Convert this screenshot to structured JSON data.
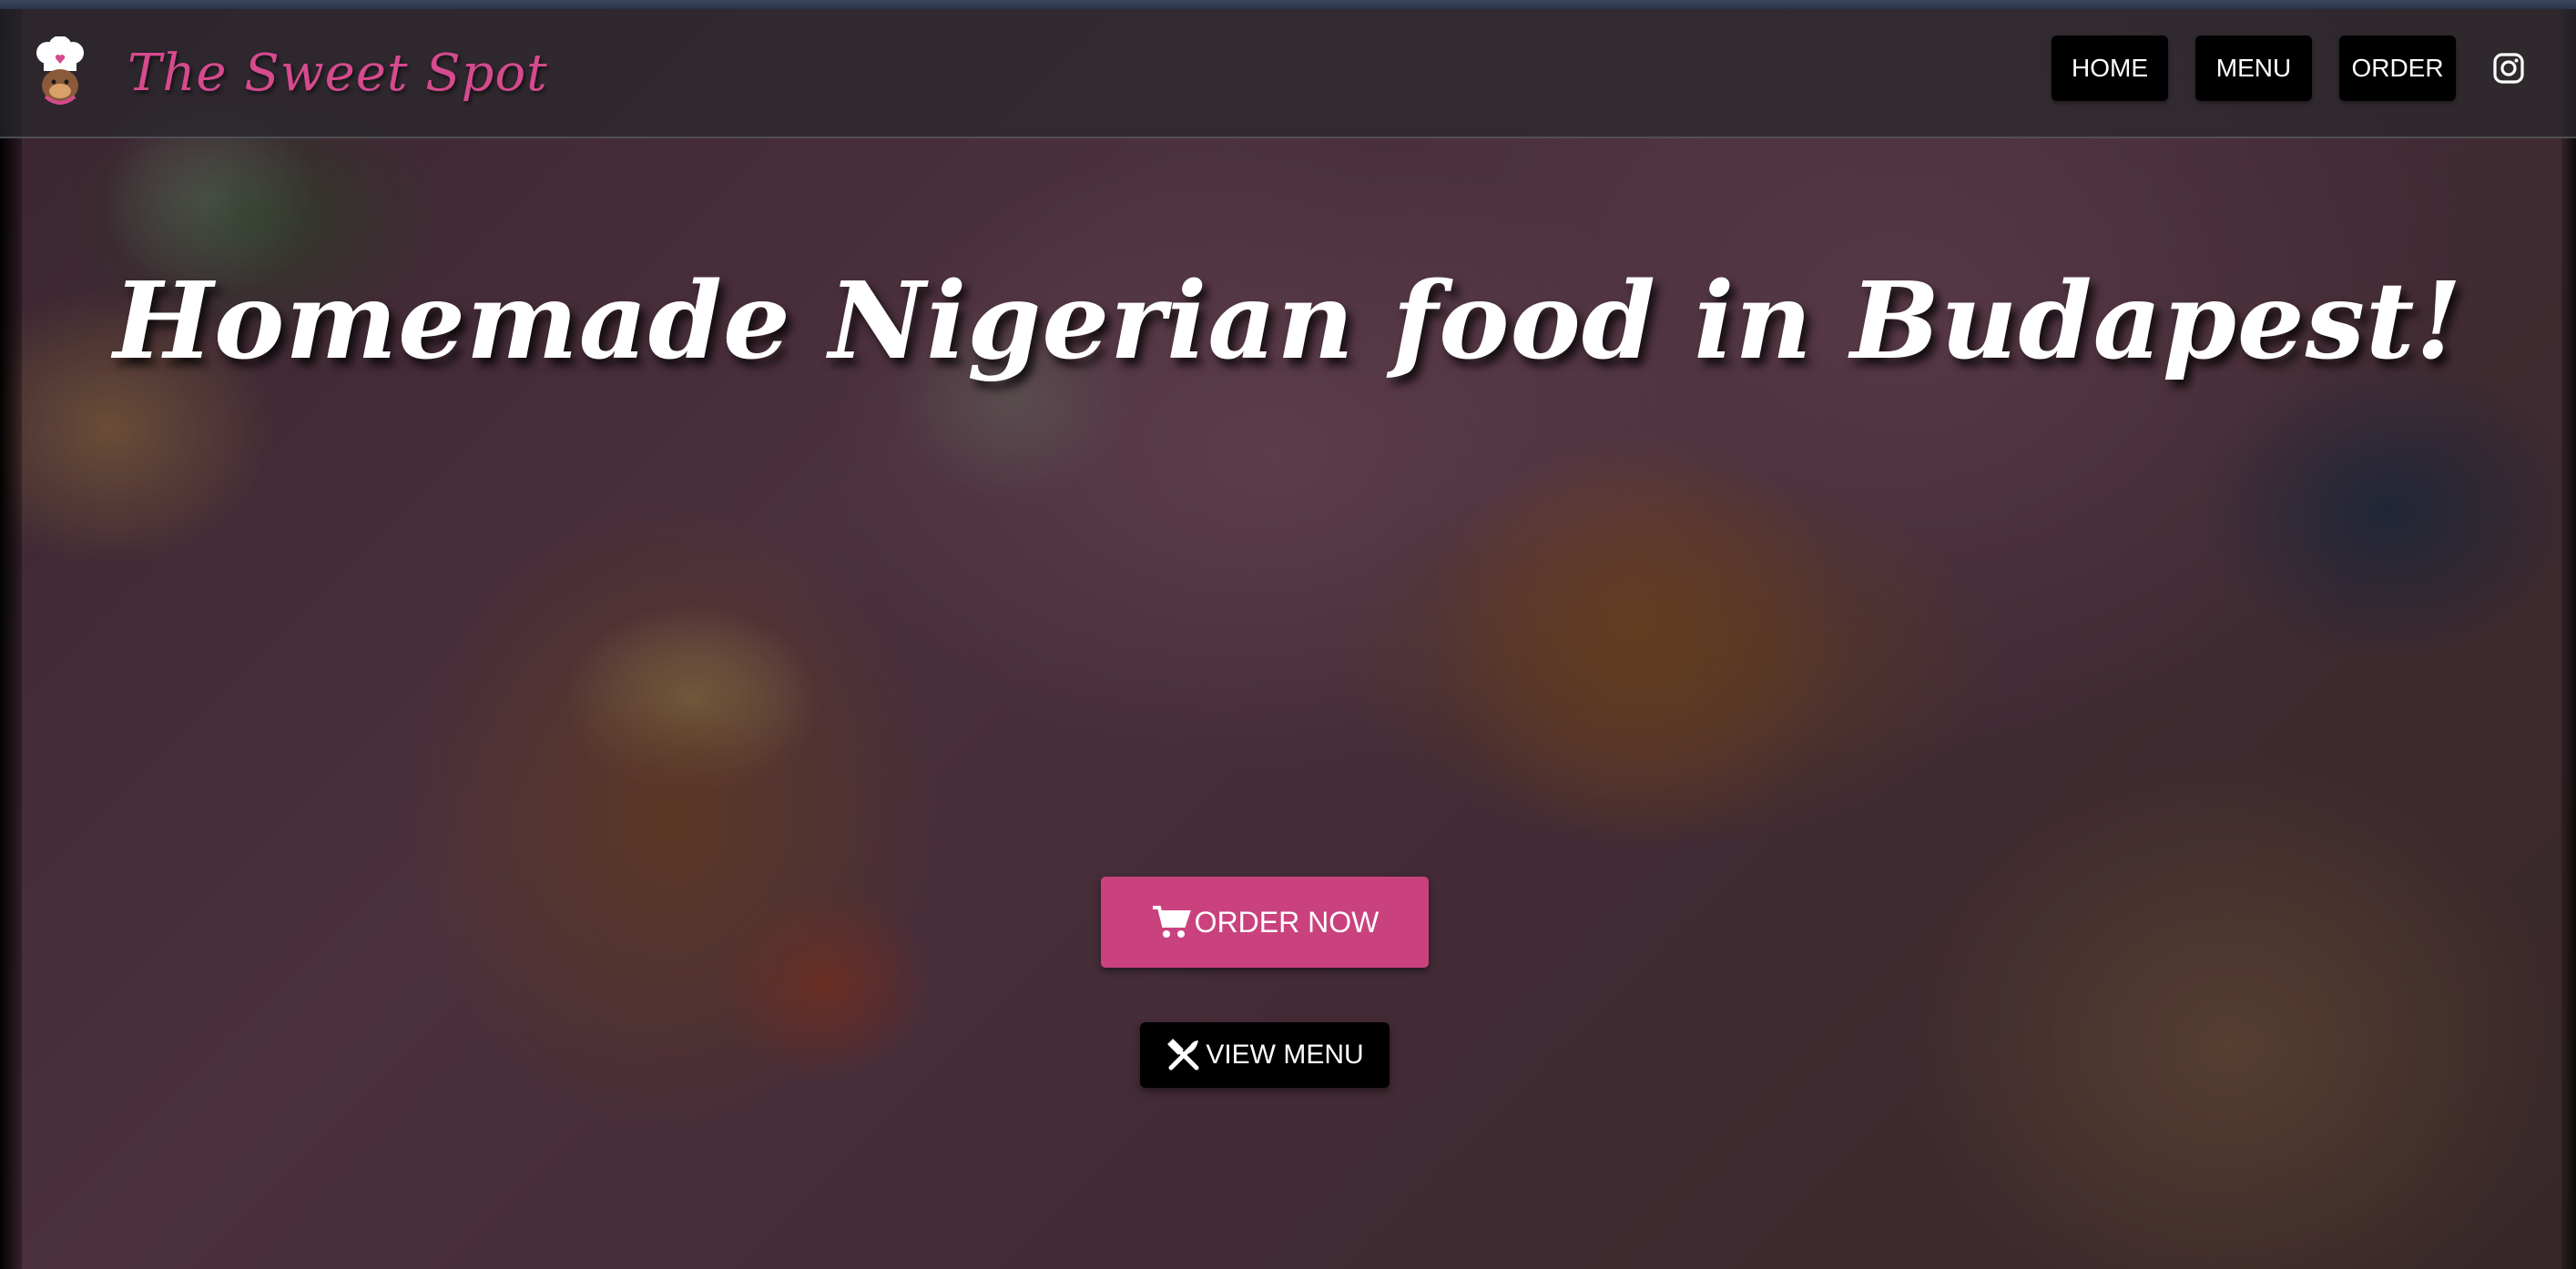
{
  "brand": {
    "name": "The Sweet Spot",
    "color": "#d64a8e"
  },
  "nav": {
    "items": [
      {
        "label": "HOME"
      },
      {
        "label": "MENU"
      },
      {
        "label": "ORDER"
      }
    ],
    "instagram_icon": "instagram-icon"
  },
  "hero": {
    "headline": "Homemade Nigerian food in Budapest!",
    "order_button": {
      "label": "ORDER NOW",
      "icon": "cart-icon",
      "color": "#c9427e"
    },
    "menu_button": {
      "label": "VIEW MENU",
      "icon": "fork-knife-icon",
      "color": "#000000"
    }
  }
}
